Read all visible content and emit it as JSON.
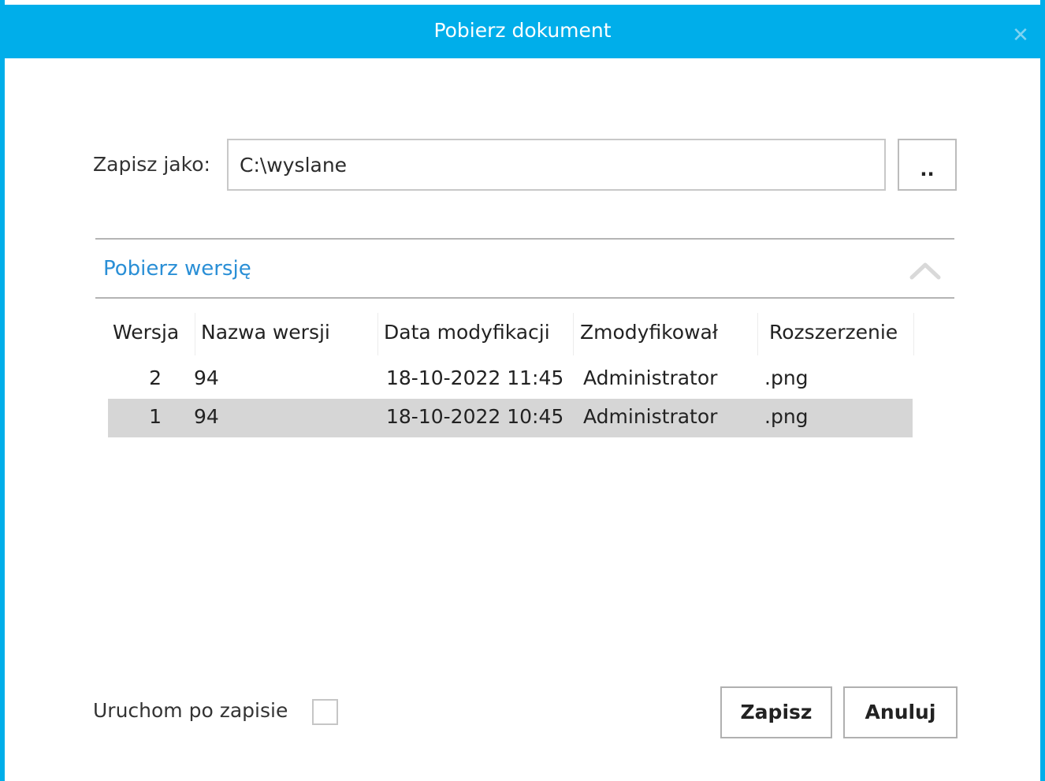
{
  "window": {
    "title": "Pobierz dokument",
    "close_glyph": "✕",
    "accent_color": "#00aeea"
  },
  "save_as": {
    "label": "Zapisz jako:",
    "value": "C:\\wyslane",
    "browse_label": ".."
  },
  "versions_section": {
    "title": "Pobierz wersję",
    "collapse_icon": "chevron-up-icon",
    "title_color": "#2a8fd6",
    "columns": [
      "Wersja",
      "Nazwa wersji",
      "Data modyfikacji",
      "Zmodyfikował",
      "Rozszerzenie"
    ],
    "rows": [
      {
        "version": "2",
        "name": "94",
        "modified": "18-10-2022 11:45",
        "modified_by": "Administrator",
        "extension": ".png",
        "selected": false
      },
      {
        "version": "1",
        "name": "94",
        "modified": "18-10-2022 10:45",
        "modified_by": "Administrator",
        "extension": ".png",
        "selected": true
      }
    ]
  },
  "launch_after_save": {
    "label": "Uruchom po zapisie",
    "checked": false
  },
  "buttons": {
    "save_label": "Zapisz",
    "cancel_label": "Anuluj"
  }
}
